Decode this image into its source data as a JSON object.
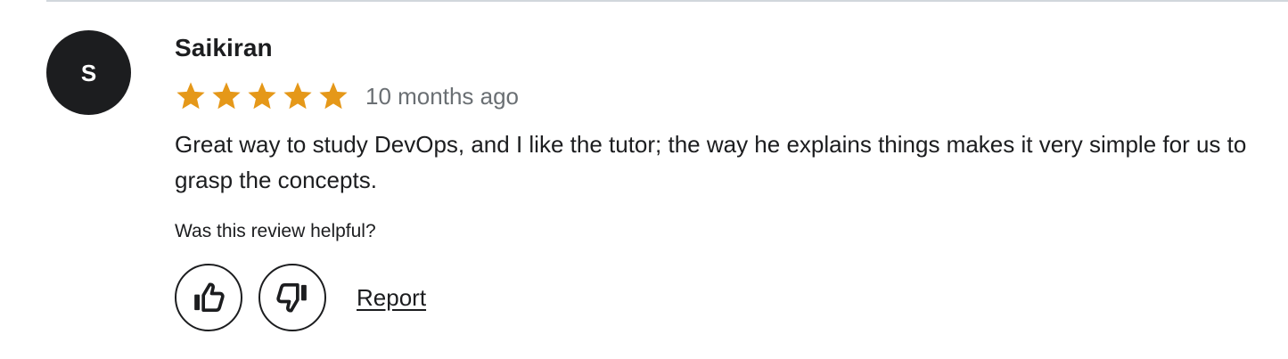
{
  "review": {
    "avatar_initial": "S",
    "reviewer_name": "Saikiran",
    "rating": 5,
    "max_rating": 5,
    "time_ago": "10 months ago",
    "text": "Great way to study DevOps, and I like the tutor; the way he explains things makes it very simple for us to grasp the concepts."
  },
  "feedback": {
    "question": "Was this review helpful?",
    "thumbs_up_icon": "thumbs-up-icon",
    "thumbs_down_icon": "thumbs-down-icon",
    "report_label": "Report"
  },
  "colors": {
    "star": "#e59819",
    "avatar_bg": "#1c1d1f",
    "muted_text": "#6a6f73",
    "divider": "#d1d7dc"
  }
}
